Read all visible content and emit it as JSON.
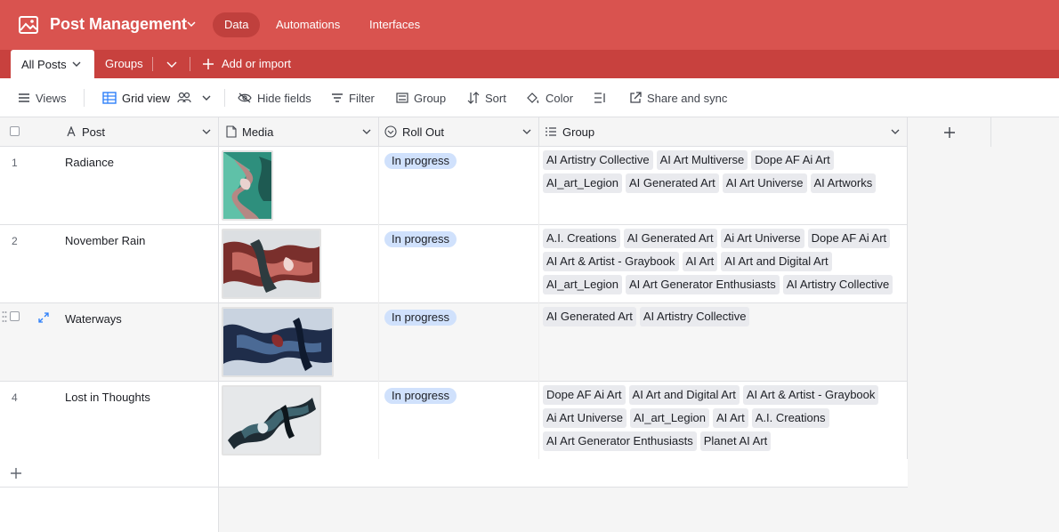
{
  "app": {
    "title": "Post Management",
    "nav": [
      "Data",
      "Automations",
      "Interfaces"
    ]
  },
  "tabs": {
    "active": "All Posts",
    "groups": "Groups",
    "add": "Add or import"
  },
  "toolbar": {
    "views": "Views",
    "grid_view": "Grid view",
    "hide_fields": "Hide fields",
    "filter": "Filter",
    "group": "Group",
    "sort": "Sort",
    "color": "Color",
    "share": "Share and sync"
  },
  "columns": [
    "Post",
    "Media",
    "Roll Out",
    "Group"
  ],
  "rows": [
    {
      "num": "1",
      "post": "Radiance",
      "status": "In progress",
      "groups": [
        "AI Artistry Collective",
        "AI Art Multiverse",
        "Dope AF Ai Art",
        "AI_art_Legion",
        "AI Generated Art",
        "AI Art Universe",
        "AI Artworks"
      ]
    },
    {
      "num": "2",
      "post": "November Rain",
      "status": "In progress",
      "groups": [
        "A.I. Creations",
        "AI Generated Art",
        "Ai Art Universe",
        "Dope AF Ai Art",
        "AI Art & Artist - Graybook",
        "AI Art",
        "AI Art and Digital Art",
        "AI_art_Legion",
        "AI Art Generator Enthusiasts",
        "AI Artistry Collective"
      ]
    },
    {
      "num": "",
      "post": "Waterways",
      "status": "In progress",
      "groups": [
        "AI Generated Art",
        "AI Artistry Collective"
      ]
    },
    {
      "num": "4",
      "post": "Lost in Thoughts",
      "status": "In progress",
      "groups": [
        "Dope AF Ai Art",
        "AI Art and Digital Art",
        "AI Art & Artist - Graybook",
        "Ai Art Universe",
        "AI_art_Legion",
        "AI Art",
        "A.I. Creations",
        "AI Art Generator Enthusiasts",
        "Planet AI Art"
      ]
    }
  ],
  "colors": {
    "header": "#d9534f",
    "tabbar": "#c8413e",
    "status_pill": "#d0e1fc",
    "tag": "#e9eaee"
  }
}
